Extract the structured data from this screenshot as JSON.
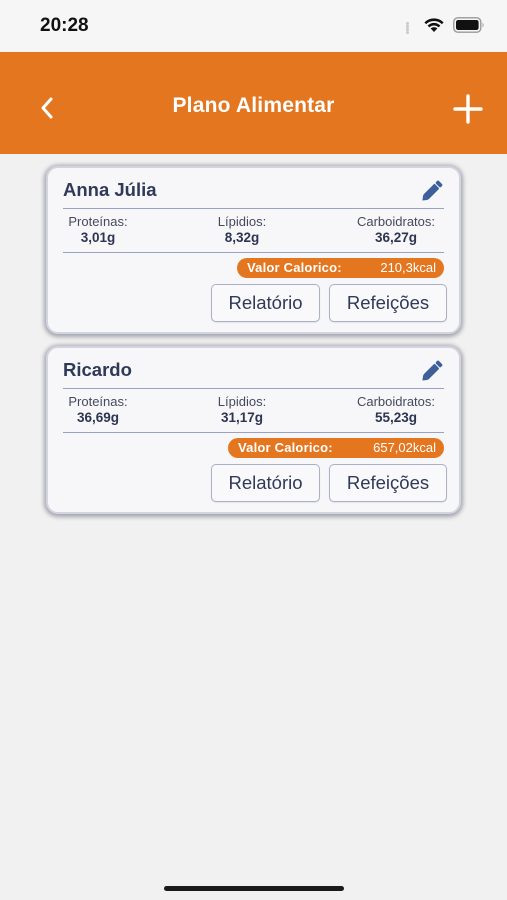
{
  "status_bar": {
    "time": "20:28",
    "icons": [
      "signal-dots-icon",
      "wifi-icon",
      "battery-icon"
    ]
  },
  "nav": {
    "title": "Plano Alimentar",
    "back_icon": "chevron-left-icon",
    "add_icon": "plus-icon"
  },
  "colors": {
    "accent": "#e4761f",
    "text_dark": "#303a58",
    "card_border": "#d2d5e0"
  },
  "cards": [
    {
      "name": "Anna Júlia",
      "edit_icon": "pencil-icon",
      "proteinas": {
        "label": "Proteínas:",
        "value": "3,01g"
      },
      "lipidios": {
        "label": "Lípidios:",
        "value": "8,32g"
      },
      "carboidratos": {
        "label": "Carboidratos:",
        "value": "36,27g"
      },
      "valor_calorico": {
        "label": "Valor Calorico:",
        "value": "210,3kcal"
      },
      "relatorio_label": "Relatório",
      "refeicoes_label": "Refeições"
    },
    {
      "name": "Ricardo",
      "edit_icon": "pencil-icon",
      "proteinas": {
        "label": "Proteínas:",
        "value": "36,69g"
      },
      "lipidios": {
        "label": "Lípidios:",
        "value": "31,17g"
      },
      "carboidratos": {
        "label": "Carboidratos:",
        "value": "55,23g"
      },
      "valor_calorico": {
        "label": "Valor Calorico:",
        "value": "657,02kcal"
      },
      "relatorio_label": "Relatório",
      "refeicoes_label": "Refeições"
    }
  ]
}
